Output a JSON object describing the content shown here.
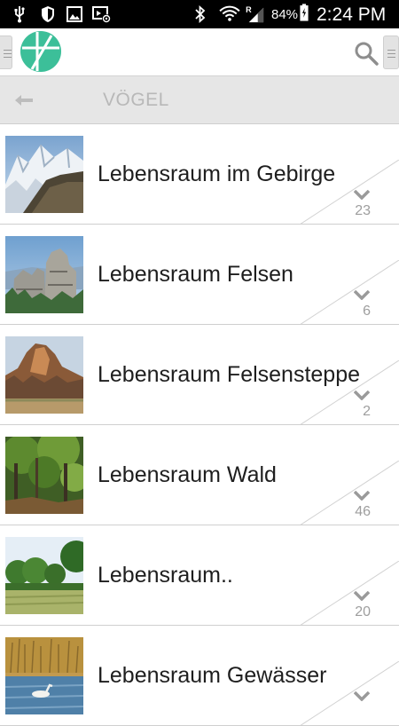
{
  "status_bar": {
    "battery": "84%",
    "time": "2:24 PM",
    "icons": [
      "usb-icon",
      "shield-icon",
      "image-icon",
      "cast-icon",
      "bluetooth-icon",
      "wifi-icon",
      "signal-icon",
      "battery-icon"
    ]
  },
  "app_bar": {
    "logo": "app-logo",
    "search_icon": "search-icon"
  },
  "sub_header": {
    "title": "VÖGEL",
    "back_icon": "back-arrow-icon"
  },
  "items": [
    {
      "label": "Lebensraum im Gebirge",
      "count": "23"
    },
    {
      "label": "Lebensraum Felsen",
      "count": "6"
    },
    {
      "label": "Lebensraum Felsensteppe",
      "count": "2"
    },
    {
      "label": "Lebensraum Wald",
      "count": "46"
    },
    {
      "label": "Lebensraum..",
      "count": "20"
    },
    {
      "label": "Lebensraum Gewässer",
      "count": ""
    }
  ],
  "colors": {
    "accent": "#3cbf99",
    "subheader_bg": "#e6e6e6",
    "divider": "#cfcfcf"
  }
}
